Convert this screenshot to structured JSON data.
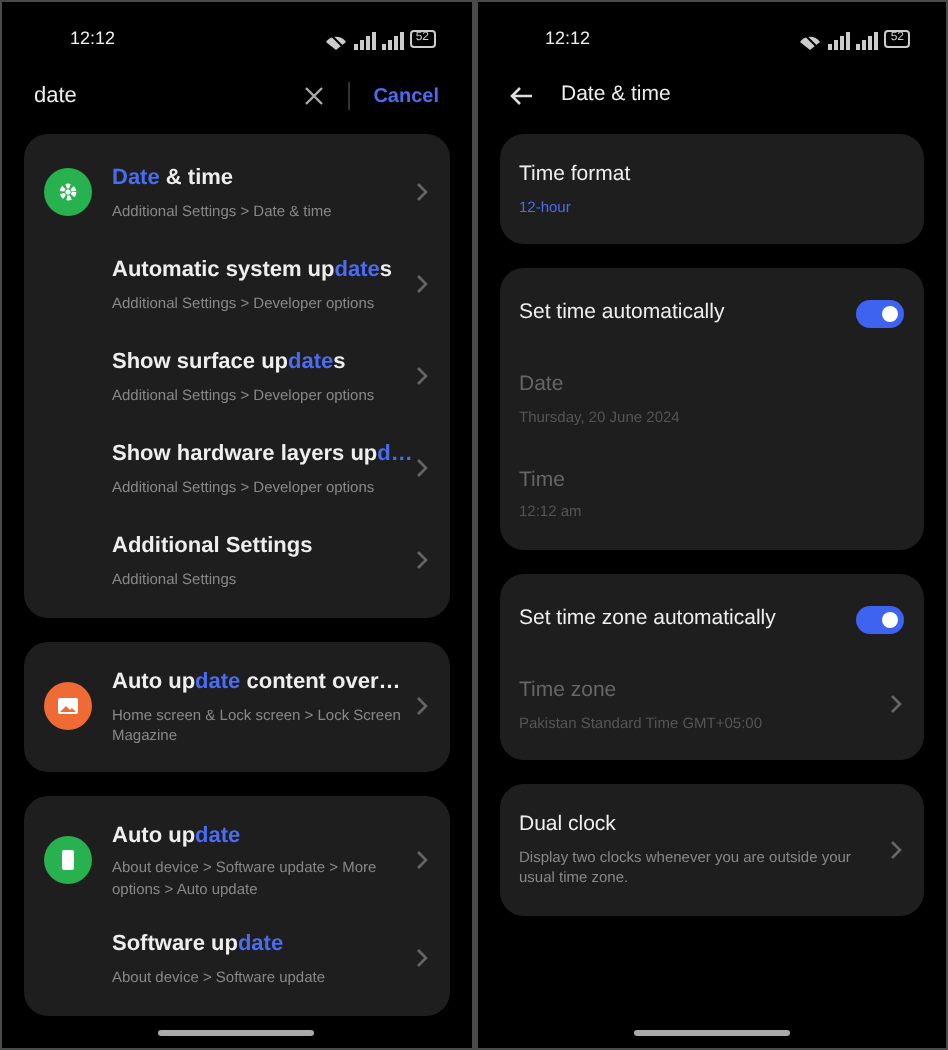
{
  "screens": [
    {
      "status_bar": {
        "time": "12:12",
        "battery": "52"
      },
      "search": {
        "value": "date",
        "cancel": "Cancel"
      },
      "groups": [
        {
          "items": [
            {
              "kind": "gear",
              "title": [
                {
                  "text": "Date",
                  "match": true
                },
                {
                  "text": " & time",
                  "match": false
                }
              ],
              "subtitle": "Additional Settings > Date & time"
            },
            {
              "kind": "plain",
              "title": [
                {
                  "text": "Automatic system up",
                  "match": false
                },
                {
                  "text": "date",
                  "match": true
                },
                {
                  "text": "s",
                  "match": false
                }
              ],
              "subtitle": "Additional Settings > Developer options"
            },
            {
              "kind": "plain",
              "title": [
                {
                  "text": "Show surface up",
                  "match": false
                },
                {
                  "text": "date",
                  "match": true
                },
                {
                  "text": "s",
                  "match": false
                }
              ],
              "subtitle": "Additional Settings > Developer options"
            },
            {
              "kind": "plain",
              "title": [
                {
                  "text": "Show hardware layers up",
                  "match": false
                },
                {
                  "text": "d…",
                  "match": true
                }
              ],
              "subtitle": "Additional Settings > Developer options"
            },
            {
              "kind": "plain",
              "title": [
                {
                  "text": "Additional Settings",
                  "match": false
                }
              ],
              "subtitle": "Additional Settings"
            }
          ]
        },
        {
          "items": [
            {
              "kind": "picture",
              "title": [
                {
                  "text": "Auto up",
                  "match": false
                },
                {
                  "text": "date",
                  "match": true
                },
                {
                  "text": " content over…",
                  "match": false
                }
              ],
              "subtitle": "Home screen & Lock screen > Lock Screen Magazine"
            }
          ]
        },
        {
          "items": [
            {
              "kind": "phone",
              "title": [
                {
                  "text": "Auto up",
                  "match": false
                },
                {
                  "text": "date",
                  "match": true
                }
              ],
              "subtitle": "About device > Software update > More options > Auto update"
            },
            {
              "kind": "plain",
              "title": [
                {
                  "text": "Software up",
                  "match": false
                },
                {
                  "text": "date",
                  "match": true
                }
              ],
              "subtitle": "About device > Software update"
            }
          ]
        }
      ]
    },
    {
      "status_bar": {
        "time": "12:12",
        "battery": "52"
      },
      "header": {
        "title": "Date & time"
      },
      "cards": [
        {
          "rows": [
            {
              "kind": "link",
              "title": "Time format",
              "value": "12-hour",
              "disabled": false,
              "chevron": false
            }
          ]
        },
        {
          "rows": [
            {
              "kind": "toggle",
              "title": "Set time automatically",
              "on": true
            },
            {
              "kind": "link",
              "title": "Date",
              "value": "Thursday, 20 June 2024",
              "disabled": true,
              "chevron": false
            },
            {
              "kind": "link",
              "title": "Time",
              "value": "12:12 am",
              "disabled": true,
              "chevron": false
            }
          ]
        },
        {
          "rows": [
            {
              "kind": "toggle",
              "title": "Set time zone automatically",
              "on": true
            },
            {
              "kind": "link",
              "title": "Time zone",
              "value": "Pakistan Standard Time GMT+05:00",
              "disabled": true,
              "chevron": true
            }
          ]
        },
        {
          "rows": [
            {
              "kind": "info",
              "title": "Dual clock",
              "value": "Display two clocks whenever you are outside your usual time zone.",
              "chevron": true
            }
          ]
        }
      ]
    }
  ]
}
